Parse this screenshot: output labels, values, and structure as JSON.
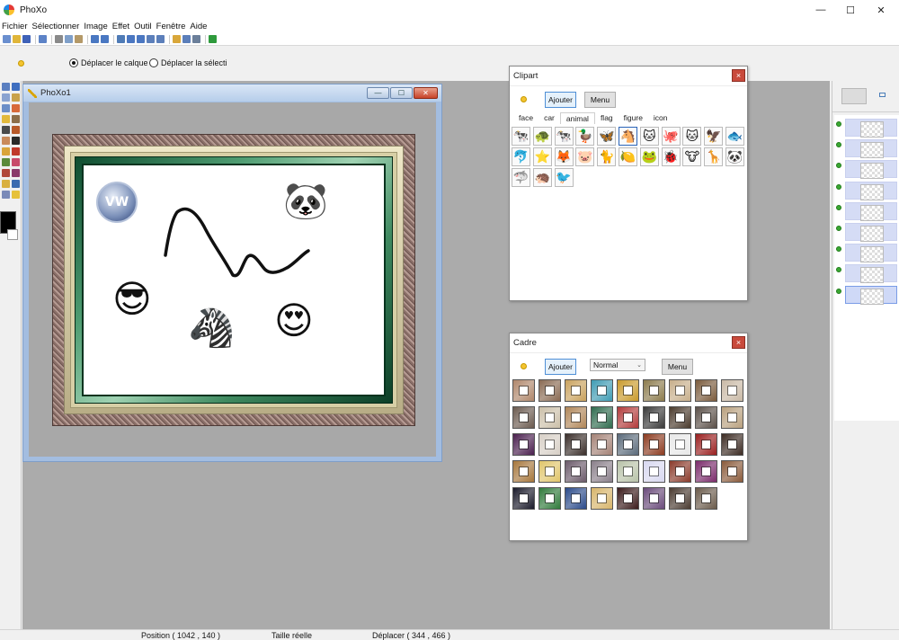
{
  "app": {
    "title": "PhoXo"
  },
  "window_controls": {
    "minimize": "—",
    "maximize": "☐",
    "close": "✕"
  },
  "menu": [
    "Fichier",
    "Sélectionner",
    "Image",
    "Effet",
    "Outil",
    "Fenêtre",
    "Aide"
  ],
  "toolbar_icons": [
    {
      "name": "new-icon",
      "color": "#6a8fcf"
    },
    {
      "name": "open-icon",
      "color": "#e0b63a"
    },
    {
      "name": "save-icon",
      "color": "#3f62b8"
    },
    {
      "name": "convert-icon",
      "color": "#5d83c7"
    },
    {
      "name": "cut-icon",
      "color": "#8a8a8a"
    },
    {
      "name": "copy-icon",
      "color": "#7f9fc9"
    },
    {
      "name": "paste-icon",
      "color": "#b49968"
    },
    {
      "name": "undo-icon",
      "color": "#4a78c2"
    },
    {
      "name": "redo-icon",
      "color": "#4a78c2"
    },
    {
      "name": "resize-icon",
      "color": "#4f7bb6"
    },
    {
      "name": "zoom-in-icon",
      "color": "#4b77c1"
    },
    {
      "name": "zoom-out-icon",
      "color": "#4b77c1"
    },
    {
      "name": "fit-icon",
      "color": "#5c7fba"
    },
    {
      "name": "actual-size-icon",
      "color": "#5c7fba"
    },
    {
      "name": "pan-icon",
      "color": "#d9a73a"
    },
    {
      "name": "select-icon",
      "color": "#5c7fba"
    },
    {
      "name": "screen-icon",
      "color": "#6b7f9a"
    },
    {
      "name": "web-icon",
      "color": "#2e9a3c"
    }
  ],
  "options": {
    "move_layer": "Déplacer le calque",
    "move_selection": "Déplacer la sélecti"
  },
  "colors": {
    "foreground": "#000000",
    "background": "#ffffff"
  },
  "document": {
    "title": "PhoXo1",
    "min": "—",
    "max": "☐",
    "close": "✕"
  },
  "canvas_clips": [
    {
      "name": "volkswagen-logo",
      "symbol": "VW"
    },
    {
      "name": "panda-clipart",
      "symbol": "🐼"
    },
    {
      "name": "cool-face-clipart",
      "symbol": "😎"
    },
    {
      "name": "zebra-clipart",
      "symbol": "🦓"
    },
    {
      "name": "heart-eyes-clipart",
      "symbol": "😍"
    }
  ],
  "clipart": {
    "title": "Clipart",
    "close": "×",
    "add": "Ajouter",
    "menu": "Menu",
    "tabs": [
      "face",
      "car",
      "animal",
      "flag",
      "figure",
      "icon"
    ],
    "selected_tab": "animal",
    "items": [
      "🐄",
      "🐢",
      "🐄",
      "🦆",
      "🦋",
      "🐴",
      "🐱",
      "🐙",
      "🐱",
      "🦅",
      "🐟",
      "🐬",
      "⭐",
      "🦊",
      "🐷",
      "🐈",
      "🍋",
      "🐸",
      "🐞",
      "🐮",
      "🦒",
      "🐼",
      "🦈",
      "🦔",
      "🐦"
    ]
  },
  "cadre": {
    "title": "Cadre",
    "close": "×",
    "add": "Ajouter",
    "mode": "Normal",
    "menu": "Menu",
    "frame_colors": [
      "#b0876b",
      "#8a6a52",
      "#c9a15c",
      "#3e9bb3",
      "#c99a2a",
      "#8c7b4c",
      "#c7ae8a",
      "#7a5a3b",
      "#c9b9a5",
      "#6b5a4f",
      "#cbbfa8",
      "#b08658",
      "#2f6b4e",
      "#b23a3a",
      "#3a3a3a",
      "#4a3a2c",
      "#5a4f48",
      "#b9a07e",
      "#4a1f4e",
      "#d7cfc6",
      "#3a2e2a",
      "#a48276",
      "#5a6a7a",
      "#8c3a1f",
      "#e8e8e8",
      "#9a1e1e",
      "#3b2a22",
      "#a7773c",
      "#e0c56a",
      "#6b5a6a",
      "#8a7f8a",
      "#b8c2a8",
      "#d8d8f0",
      "#8a3a2a",
      "#7a2a6a",
      "#8a5a3a",
      "#1a1a2a",
      "#2f7a3a",
      "#2a4a8a",
      "#d7b46a",
      "#3a1a1a",
      "#6a4a7a",
      "#4a3a30",
      "#6a5a4a"
    ]
  },
  "layers": {
    "count": 9,
    "selected": 8
  },
  "status": {
    "position": "Position ( 1042 , 140 )",
    "size": "Taille réelle",
    "move": "Déplacer ( 344 , 466 )"
  }
}
